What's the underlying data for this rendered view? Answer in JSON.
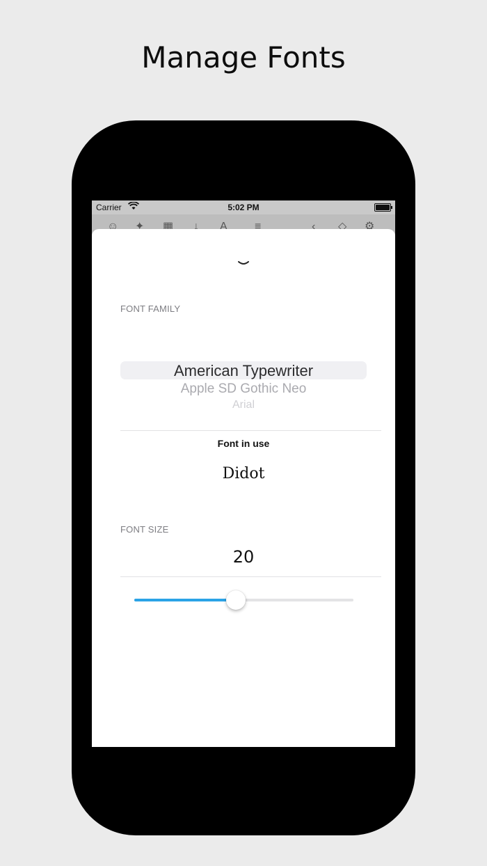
{
  "headline": "Manage Fonts",
  "status_bar": {
    "carrier": "Carrier",
    "time": "5:02 PM"
  },
  "sheet": {
    "font_family_label": "FONT FAMILY",
    "picker_items": [
      "American Typewriter",
      "Apple SD Gothic Neo",
      "Arial"
    ],
    "font_in_use_label": "Font in use",
    "font_in_use_value": "Didot",
    "font_size_label": "FONT SIZE",
    "font_size_value": "20",
    "slider_fraction": 0.465
  },
  "colors": {
    "accent": "#2ba3e6",
    "background": "#ebebeb"
  }
}
